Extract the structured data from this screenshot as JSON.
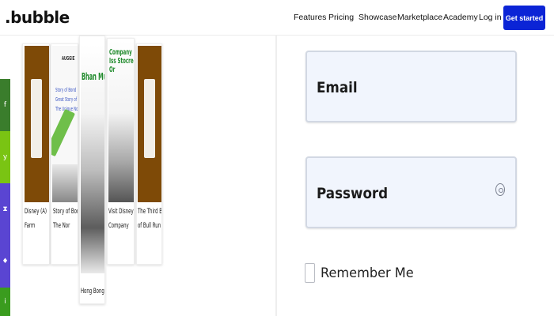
{
  "header": {
    "logo": ".bubble",
    "nav": [
      "Features",
      "Pricing",
      "Showcase",
      "Marketplace",
      "Academy",
      "Log in"
    ],
    "cta": "Get started"
  },
  "social": [
    {
      "icon": "facebook-icon",
      "glyph": "f",
      "color": "#3a7d2c"
    },
    {
      "icon": "twitter-icon",
      "glyph": "y",
      "color": "#7ac413"
    },
    {
      "icon": "bookmark-icon",
      "glyph": "⧗",
      "color": "#5a45d2"
    },
    {
      "icon": "pinterest-icon",
      "glyph": "♦",
      "color": "#5a45d2"
    },
    {
      "icon": "linkedin-icon",
      "glyph": "i",
      "color": "#3a9c1e"
    }
  ],
  "showcase": {
    "cards": [
      {
        "caption": "Disney (A)\nFarm"
      },
      {
        "caption": "Story of Bond\nThe Nor",
        "title": "AUGGIE\n",
        "subtitle": "Story of Bond\nGreat Story of\nThe Unique Nor"
      },
      {
        "caption": "Hong Bonga",
        "title": "Bhan Mun Mid"
      },
      {
        "caption": "Visit Disney\nCompany",
        "title": "Company Finas\nIss Stocreg\nOr"
      },
      {
        "caption": "The Third Battle\nof Bull Run The"
      }
    ]
  },
  "form": {
    "email_label": "Email",
    "password_label": "Password",
    "remember_label": "Remember Me"
  }
}
